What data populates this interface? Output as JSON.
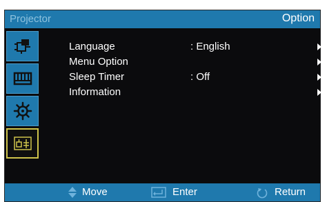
{
  "header": {
    "left_title": "Projector",
    "right_title": "Option"
  },
  "sidebar": {
    "items": [
      {
        "icon": "input-source-icon"
      },
      {
        "icon": "keyboard-icon"
      },
      {
        "icon": "settings-gear-icon"
      },
      {
        "icon": "display-options-icon"
      }
    ]
  },
  "menu": {
    "items": [
      {
        "label": "Language",
        "value": ": English",
        "has_submenu": true
      },
      {
        "label": "Menu Option",
        "value": "",
        "has_submenu": true
      },
      {
        "label": "Sleep Timer",
        "value": ": Off",
        "has_submenu": true
      },
      {
        "label": "Information",
        "value": "",
        "has_submenu": true
      }
    ]
  },
  "footer": {
    "move_label": "Move",
    "enter_label": "Enter",
    "return_label": "Return"
  },
  "colors": {
    "bar": "#1f79ad",
    "background": "#0b0b0d",
    "selected_border": "#cfc44b"
  }
}
